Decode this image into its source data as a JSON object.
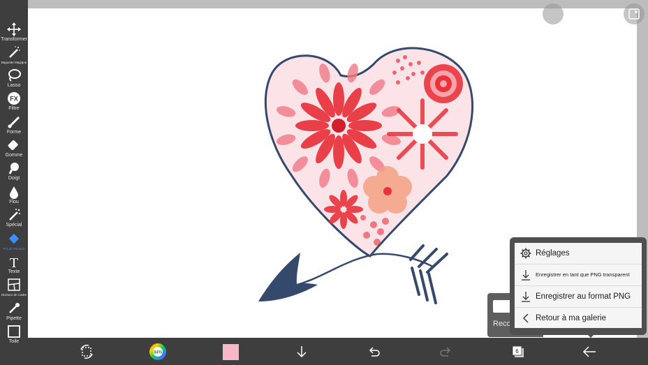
{
  "toolbar": {
    "items": [
      {
        "label": "Transformer",
        "icon": "move-arrows-icon"
      },
      {
        "label": "Baguette Magique",
        "icon": "magic-wand-icon"
      },
      {
        "label": "Lasso",
        "icon": "lasso-icon"
      },
      {
        "label": "Filtre",
        "icon": "fx-icon",
        "glyph": "FX"
      },
      {
        "label": "Forme",
        "icon": "brush-icon"
      },
      {
        "label": "Gomme",
        "icon": "eraser-icon"
      },
      {
        "label": "Doigt",
        "icon": "finger-icon"
      },
      {
        "label": "Flou",
        "icon": "drop-icon"
      },
      {
        "label": "Spécial",
        "icon": "special-brush-icon"
      },
      {
        "label": "Pot de Peinture",
        "icon": "paint-bucket-icon",
        "active": true
      },
      {
        "label": "Texte",
        "icon": "text-icon",
        "glyph": "T"
      },
      {
        "label": "Diviseur de Cadre",
        "icon": "frame-divider-icon"
      },
      {
        "label": "Pipette",
        "icon": "eyedropper-icon"
      },
      {
        "label": "Toile",
        "icon": "canvas-icon"
      }
    ]
  },
  "bottombar": {
    "color_wheel_label": "84%",
    "current_color": "#f6b8c6",
    "layers_count": "6"
  },
  "recorder": {
    "label": "Reco"
  },
  "menu": {
    "items": [
      {
        "label": "Réglages",
        "icon": "gear-icon"
      },
      {
        "label": "Enregistrer en tant que PNG transparent",
        "icon": "download-icon"
      },
      {
        "label": "Enregistrer au format PNG",
        "icon": "download-icon"
      },
      {
        "label": "Retour à ma galerie",
        "icon": "chevron-left-icon"
      }
    ]
  },
  "colors": {
    "toolbar_bg": "#3e3e3e",
    "accent": "#3d8ef8",
    "arrow_navy": "#34496b",
    "heart_fill": "#fbe3e8",
    "flower_red": "#e8323c"
  }
}
